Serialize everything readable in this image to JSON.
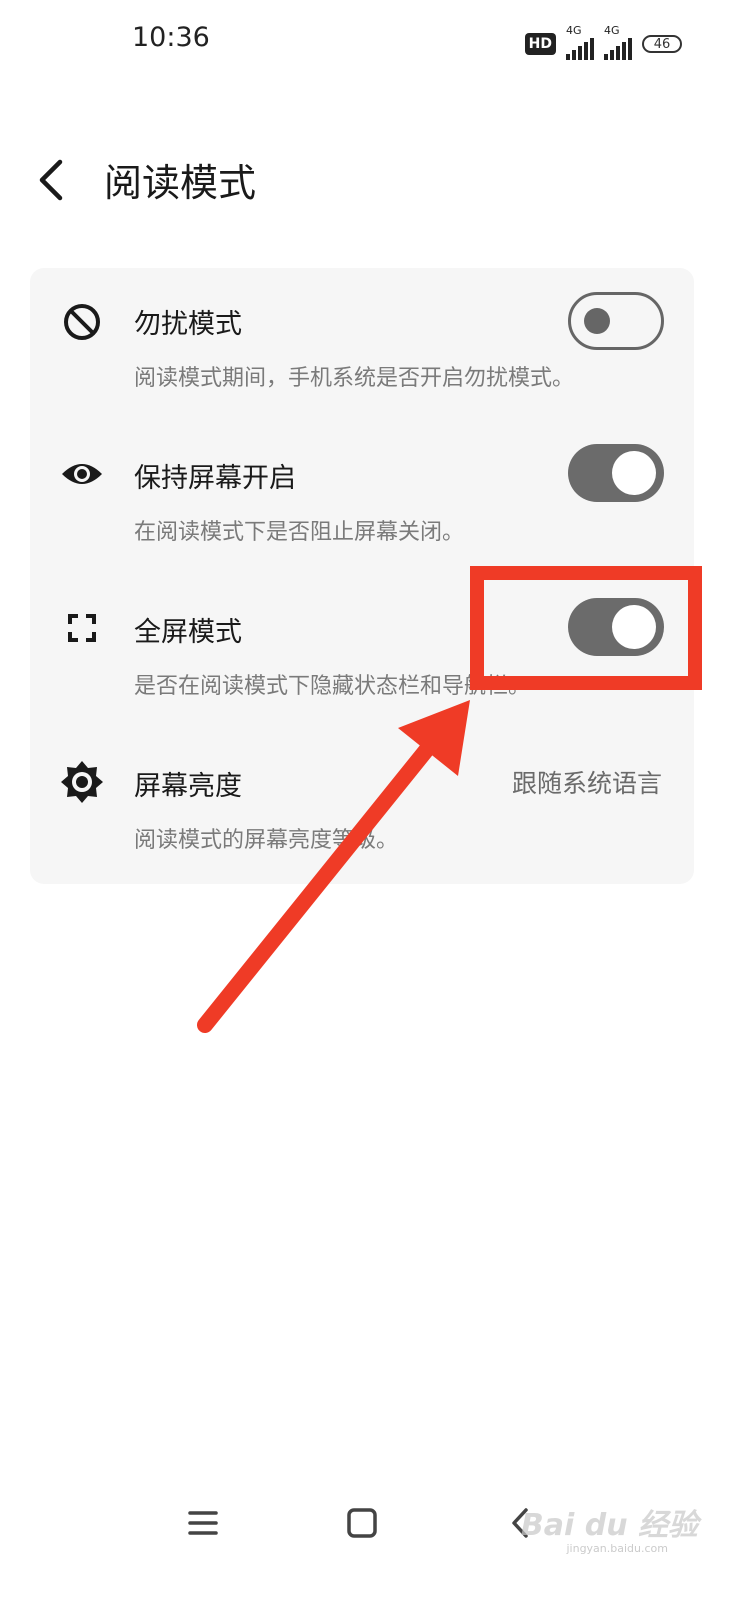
{
  "status_bar": {
    "time": "10:36",
    "hd_label": "HD",
    "network_1": "4G",
    "network_2": "4G",
    "battery": "46"
  },
  "header": {
    "title": "阅读模式"
  },
  "settings": [
    {
      "icon": "do-not-disturb-icon",
      "title": "勿扰模式",
      "description": "阅读模式期间，手机系统是否开启勿扰模式。",
      "control": "toggle",
      "enabled": false
    },
    {
      "icon": "eye-icon",
      "title": "保持屏幕开启",
      "description": "在阅读模式下是否阻止屏幕关闭。",
      "control": "toggle",
      "enabled": true
    },
    {
      "icon": "fullscreen-icon",
      "title": "全屏模式",
      "description": "是否在阅读模式下隐藏状态栏和导航栏。",
      "control": "toggle",
      "enabled": true
    },
    {
      "icon": "brightness-icon",
      "title": "屏幕亮度",
      "description": "阅读模式的屏幕亮度等级。",
      "control": "value",
      "value": "跟随系统语言"
    }
  ],
  "annotation": {
    "color": "#ef3b26"
  },
  "nav": {
    "menu_icon": "menu-icon",
    "home_icon": "home-square-icon",
    "back_icon": "back-chevron-icon"
  },
  "watermark": {
    "text": "Bai du 经验",
    "sub": "jingyan.baidu.com"
  }
}
